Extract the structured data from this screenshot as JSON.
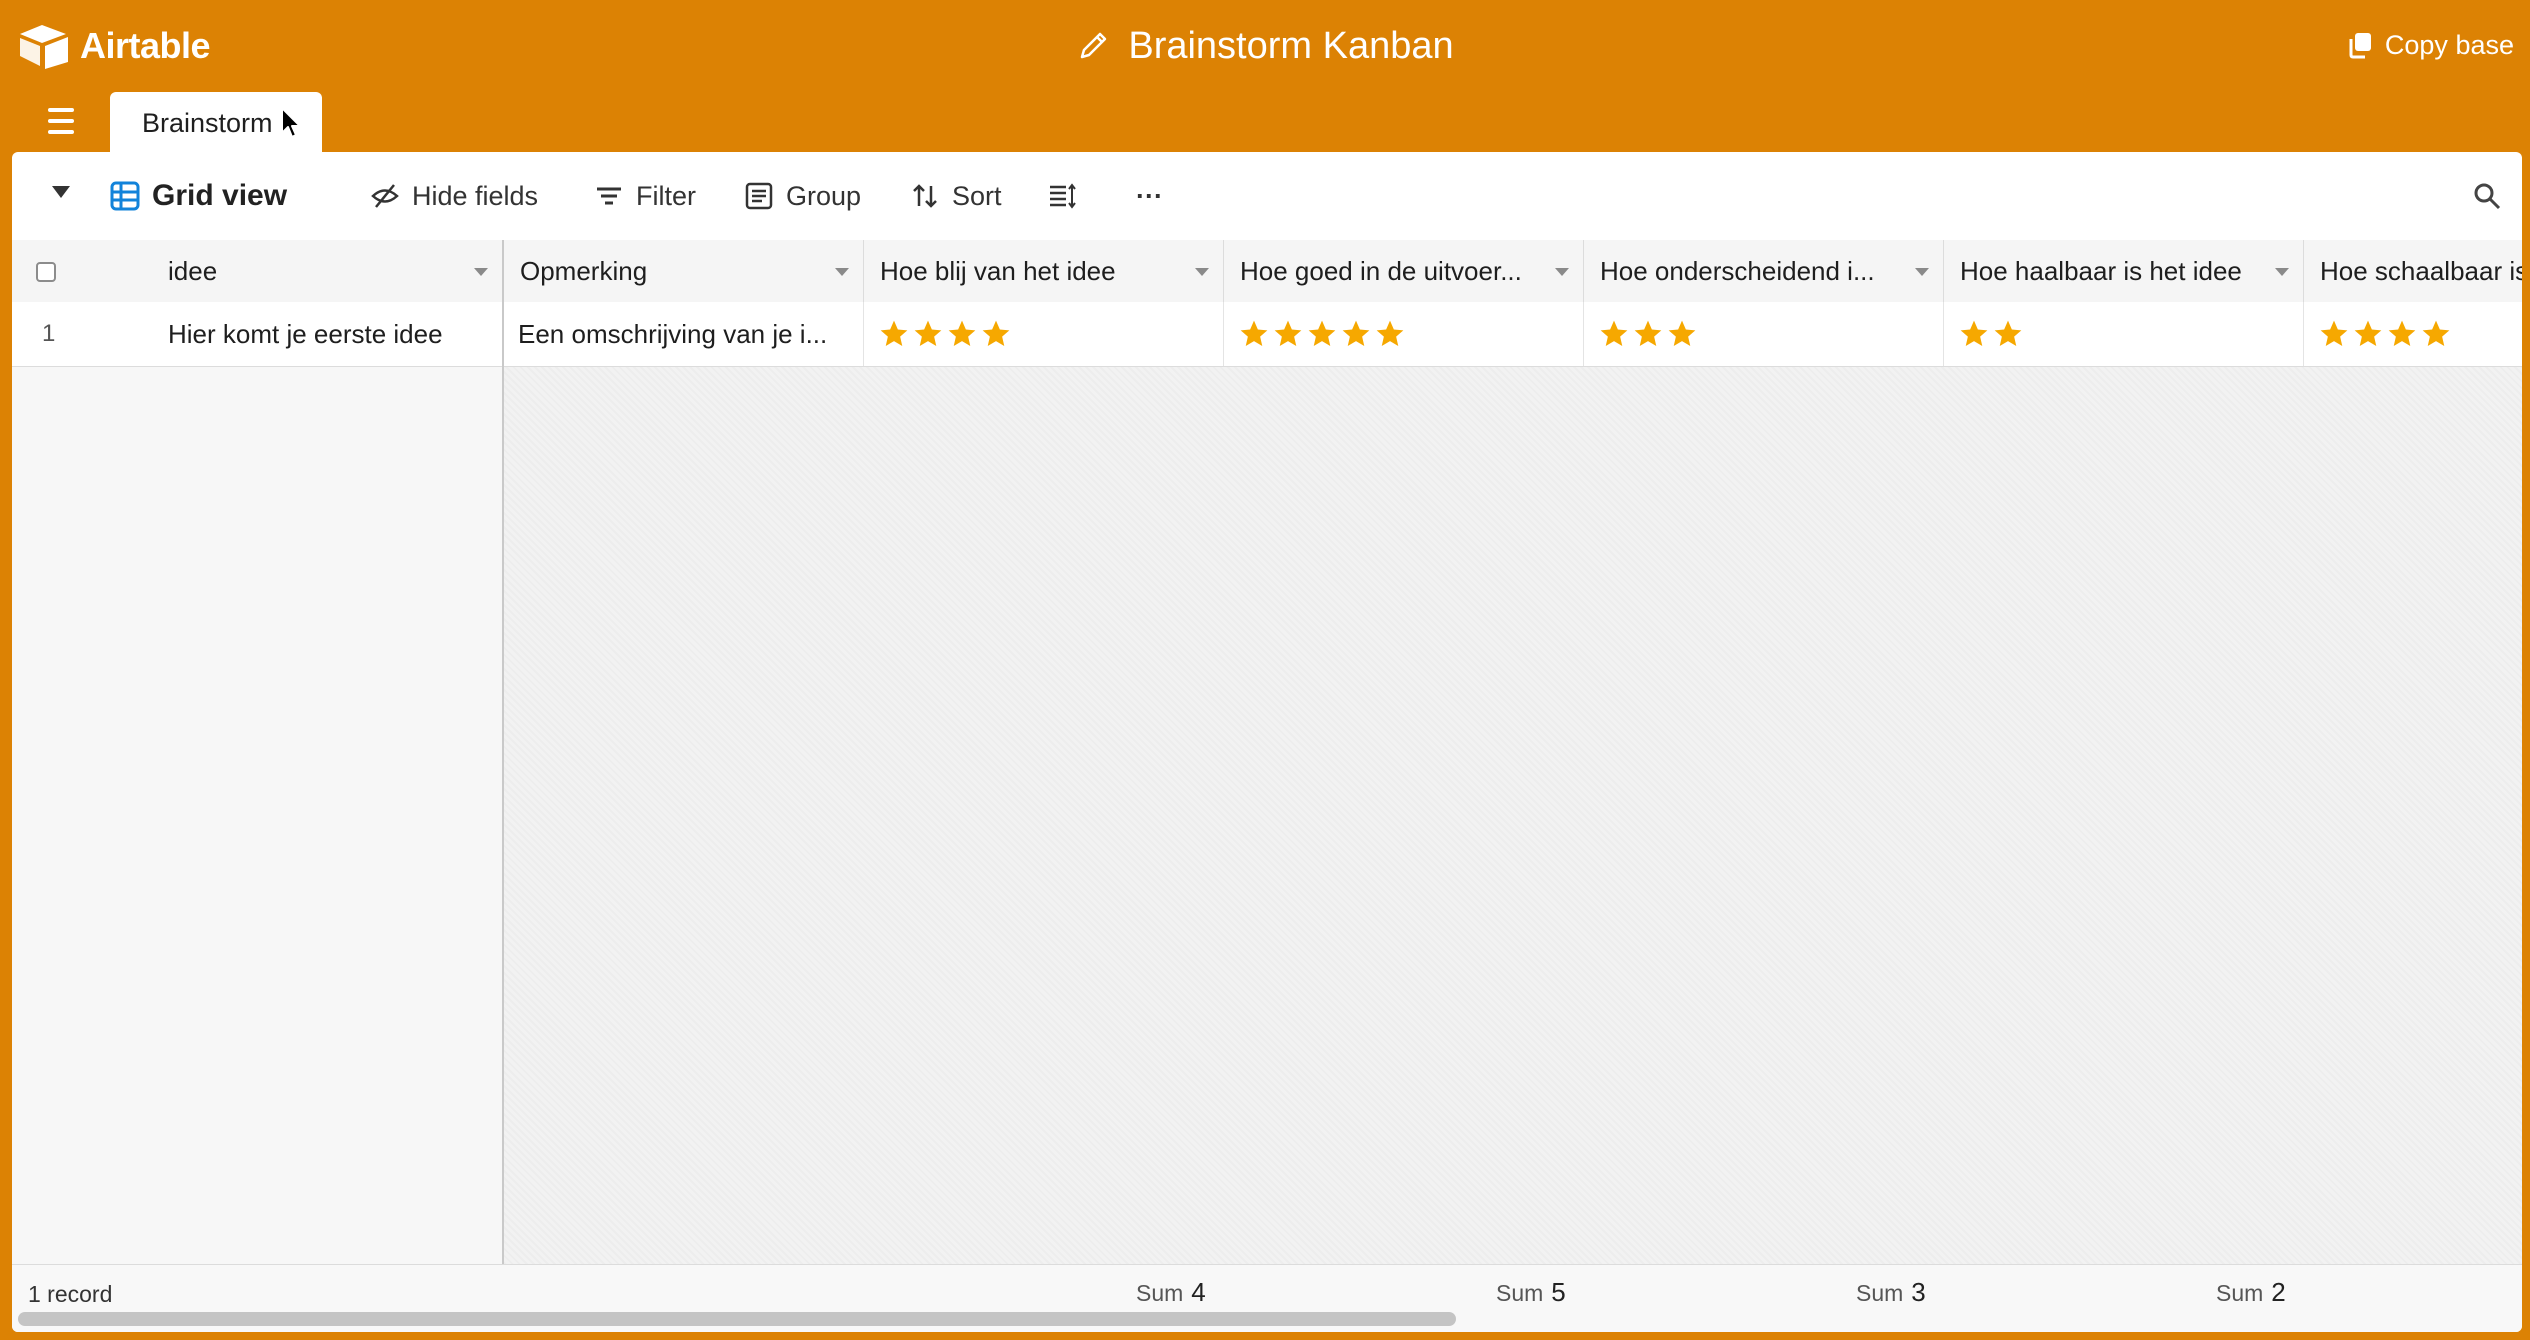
{
  "app": {
    "name": "Airtable"
  },
  "base": {
    "title": "Brainstorm Kanban",
    "copy_label": "Copy base"
  },
  "tabs": [
    {
      "label": "Brainstorm"
    }
  ],
  "toolbar": {
    "view_label": "Grid view",
    "hide_fields": "Hide fields",
    "filter": "Filter",
    "group": "Group",
    "sort": "Sort",
    "more": "···"
  },
  "columns": [
    {
      "label": "idee"
    },
    {
      "label": "Opmerking"
    },
    {
      "label": "Hoe blij van het idee"
    },
    {
      "label": "Hoe goed in de uitvoer..."
    },
    {
      "label": "Hoe onderscheidend i..."
    },
    {
      "label": "Hoe haalbaar is het idee"
    },
    {
      "label": "Hoe schaalbaar is"
    }
  ],
  "rows": [
    {
      "number": "1",
      "idee": "Hier komt je eerste idee",
      "opmerking": "Een omschrijving van je i...",
      "ratings": [
        4,
        5,
        3,
        2,
        4
      ]
    }
  ],
  "footer": {
    "record_count": "1 record",
    "sum_label": "Sum",
    "sums": [
      "4",
      "5",
      "3",
      "2"
    ]
  },
  "colors": {
    "brand": "#dc8204",
    "star": "#f6a800",
    "accent": "#1283da"
  }
}
